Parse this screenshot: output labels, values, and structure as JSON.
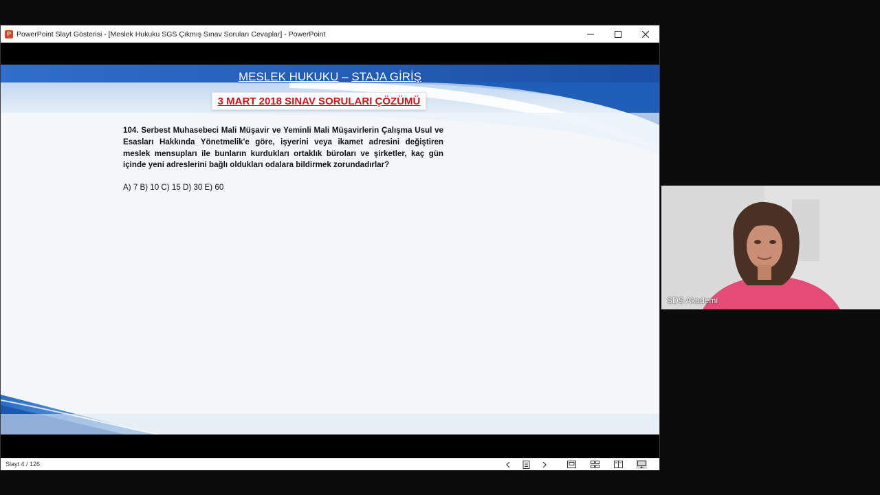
{
  "window": {
    "title": "PowerPoint Slayt Gösterisi - [Meslek Hukuku SGS Çıkmış Sınav Soruları Cevaplar] - PowerPoint",
    "app_icon_letter": "P",
    "app_icon": "powerpoint-icon"
  },
  "slide": {
    "header_left": "MESLEK HUKUKU",
    "header_sep": " – ",
    "header_right": "STAJA GİRİŞ",
    "exam_title": "3 MART 2018 SINAV SORULARI ÇÖZÜMÜ",
    "question": "104. Serbest Muhasebeci Mali Müşavir ve Yeminli Mali Müşavirlerin Çalışma Usul ve Esasları Hakkında Yönetmelik'e göre, işyerini veya ikamet adresini değiştiren meslek mensupları ile bunların kurdukları ortaklık büroları ve şirketler, kaç gün içinde yeni adreslerini bağlı oldukları odalara bildirmek zorundadırlar?",
    "answers": "A) 7 B) 10 C) 15 D) 30 E) 60",
    "colors": {
      "header_blue": "#1f5fb8",
      "exam_title_red": "#c8151b"
    }
  },
  "statusbar": {
    "slide_counter": "Slayt 4 / 126",
    "icons": [
      "chevron-left-icon",
      "slide-menu-icon",
      "chevron-right-icon",
      "normal-view-icon",
      "slide-sorter-icon",
      "reading-view-icon",
      "slideshow-icon"
    ]
  },
  "video": {
    "participant_name": "SDS Akademi"
  }
}
